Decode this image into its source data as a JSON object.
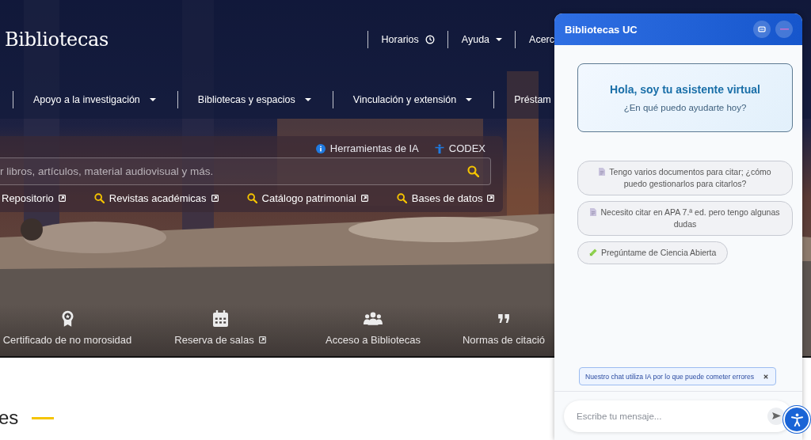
{
  "header": {
    "logo": "Bibliotecas",
    "top_nav": [
      {
        "label": "Horarios",
        "kind": "clock"
      },
      {
        "label": "Ayuda",
        "kind": "dropdown"
      },
      {
        "label": "Acerc",
        "kind": "plain"
      }
    ]
  },
  "main_nav": [
    {
      "label": "Apoyo a la investigación",
      "kind": "dropdown"
    },
    {
      "label": "Bibliotecas y espacios",
      "kind": "dropdown"
    },
    {
      "label": "Vinculación y extensión",
      "kind": "dropdown"
    },
    {
      "label": "Préstam",
      "kind": "plain"
    }
  ],
  "search": {
    "tools": [
      {
        "label": "Herramientas de IA",
        "kind": "info"
      },
      {
        "label": "CODEX",
        "kind": "person"
      }
    ],
    "placeholder": "r libros, artículos, material audiovisual y más.",
    "quick_links": [
      {
        "label": "Repositorio",
        "kind": "plain",
        "external": true
      },
      {
        "label": "Revistas académicas",
        "kind": "search",
        "external": true
      },
      {
        "label": "Catálogo patrimonial",
        "kind": "search",
        "external": true
      },
      {
        "label": "Bases de datos",
        "kind": "search",
        "external": true
      }
    ]
  },
  "shortcuts": [
    {
      "label": "Certificado de no morosidad",
      "kind": "award",
      "external": false
    },
    {
      "label": "Reserva de salas",
      "kind": "calendar",
      "external": true
    },
    {
      "label": "Acceso a Bibliotecas",
      "kind": "people",
      "external": false
    },
    {
      "label": "Normas de citació",
      "kind": "quote",
      "external": false
    }
  ],
  "section": {
    "heading": "es"
  },
  "chat": {
    "title": "Bibliotecas UC",
    "greeting": {
      "title": "Hola, soy tu asistente virtual",
      "subtitle": "¿En qué puedo ayudarte hoy?"
    },
    "suggestions": [
      {
        "text": "Tengo varios documentos para citar; ¿cómo puedo gestionarlos para citarlos?",
        "kind": "document"
      },
      {
        "text": "Necesito citar en APA 7.ª ed. pero tengo algunas dudas",
        "kind": "document"
      },
      {
        "text": "Pregúntame de Ciencia Abierta",
        "kind": "tube"
      }
    ],
    "notice": "Nuestro chat utiliza IA por lo que puede cometer errores",
    "input": {
      "placeholder": "Escribe tu mensaje..."
    }
  }
}
